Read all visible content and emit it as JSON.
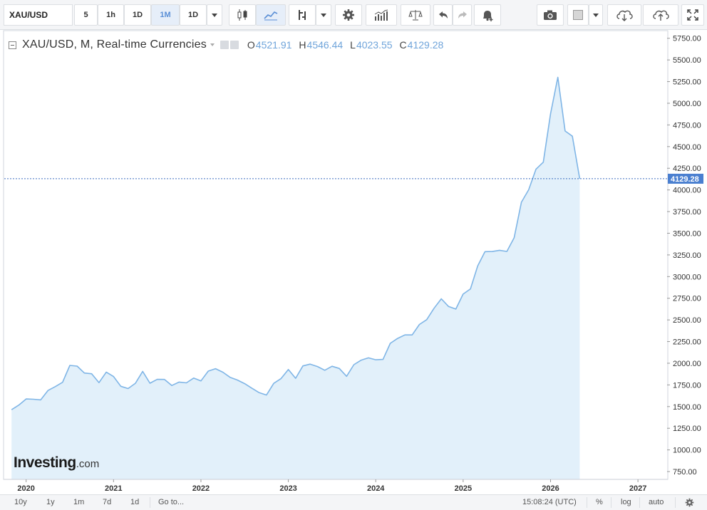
{
  "toolbar": {
    "symbol": "XAU/USD",
    "intervals": [
      "5",
      "1h",
      "1D",
      "1M",
      "1D"
    ],
    "active_interval": "1M"
  },
  "legend": {
    "title": "XAU/USD, M, Real-time Currencies",
    "open_key": "O",
    "open": "4521.91",
    "high_key": "H",
    "high": "4546.44",
    "low_key": "L",
    "low": "4023.55",
    "close_key": "C",
    "close": "4129.28"
  },
  "bottom": {
    "ranges": [
      "10y",
      "1y",
      "1m",
      "7d",
      "1d"
    ],
    "goto": "Go to...",
    "time": "15:08:24 (UTC)",
    "percent": "%",
    "log": "log",
    "auto": "auto"
  },
  "watermark": {
    "brand": "Investing",
    "suffix": ".com"
  },
  "colors": {
    "line": "#7fb5e6",
    "area": "#e2f0fa",
    "accent": "#3d6fc0",
    "price_label_bg": "#4a7fd0"
  },
  "chart_data": {
    "type": "area",
    "title": "XAU/USD, M, Real-time Currencies",
    "xlabel": "",
    "ylabel": "",
    "x_tick_labels": [
      "2020",
      "2021",
      "2022",
      "2023",
      "2024",
      "2025",
      "2026",
      "2027"
    ],
    "y_tick_labels": [
      "750.00",
      "1000.00",
      "1250.00",
      "1500.00",
      "1750.00",
      "2000.00",
      "2250.00",
      "2500.00",
      "2750.00",
      "3000.00",
      "3250.00",
      "3500.00",
      "3750.00",
      "4000.00",
      "4250.00",
      "4500.00",
      "4750.00",
      "5000.00",
      "5250.00",
      "5500.00",
      "5750.00"
    ],
    "ylim": [
      660,
      5830
    ],
    "xlim": [
      "2019-10",
      "2027-05"
    ],
    "last_price_label": "4129.28",
    "grid": false,
    "series": [
      {
        "x": [
          "2019-11",
          "2019-12",
          "2020-01",
          "2020-02",
          "2020-03",
          "2020-04",
          "2020-05",
          "2020-06",
          "2020-07",
          "2020-08",
          "2020-09",
          "2020-10",
          "2020-11",
          "2020-12",
          "2021-01",
          "2021-02",
          "2021-03",
          "2021-04",
          "2021-05",
          "2021-06",
          "2021-07",
          "2021-08",
          "2021-09",
          "2021-10",
          "2021-11",
          "2021-12",
          "2022-01",
          "2022-02",
          "2022-03",
          "2022-04",
          "2022-05",
          "2022-06",
          "2022-07",
          "2022-08",
          "2022-09",
          "2022-10",
          "2022-11",
          "2022-12",
          "2023-01",
          "2023-02",
          "2023-03",
          "2023-04",
          "2023-05",
          "2023-06",
          "2023-07",
          "2023-08",
          "2023-09",
          "2023-10",
          "2023-11",
          "2023-12",
          "2024-01",
          "2024-02",
          "2024-03",
          "2024-04",
          "2024-05",
          "2024-06",
          "2024-07",
          "2024-08",
          "2024-09",
          "2024-10",
          "2024-11",
          "2024-12",
          "2025-01",
          "2025-02",
          "2025-03",
          "2025-04",
          "2025-05",
          "2025-06",
          "2025-07",
          "2025-08",
          "2025-09",
          "2025-10",
          "2025-11",
          "2025-12",
          "2026-01",
          "2026-02",
          "2026-03",
          "2026-04",
          "2026-05"
        ],
        "values": [
          1464,
          1517,
          1588,
          1585,
          1577,
          1686,
          1730,
          1780,
          1975,
          1967,
          1887,
          1879,
          1776,
          1898,
          1847,
          1734,
          1708,
          1769,
          1906,
          1770,
          1814,
          1813,
          1743,
          1783,
          1774,
          1829,
          1796,
          1909,
          1937,
          1897,
          1838,
          1807,
          1765,
          1711,
          1660,
          1633,
          1768,
          1824,
          1928,
          1826,
          1969,
          1990,
          1962,
          1919,
          1965,
          1940,
          1849,
          1983,
          2036,
          2062,
          2040,
          2044,
          2230,
          2287,
          2327,
          2327,
          2448,
          2503,
          2634,
          2744,
          2655,
          2625,
          2798,
          2858,
          3124,
          3288,
          3289,
          3303,
          3290,
          3448,
          3858,
          4002,
          4239,
          4320,
          4880,
          5300,
          4680,
          4620,
          4129
        ]
      }
    ]
  }
}
